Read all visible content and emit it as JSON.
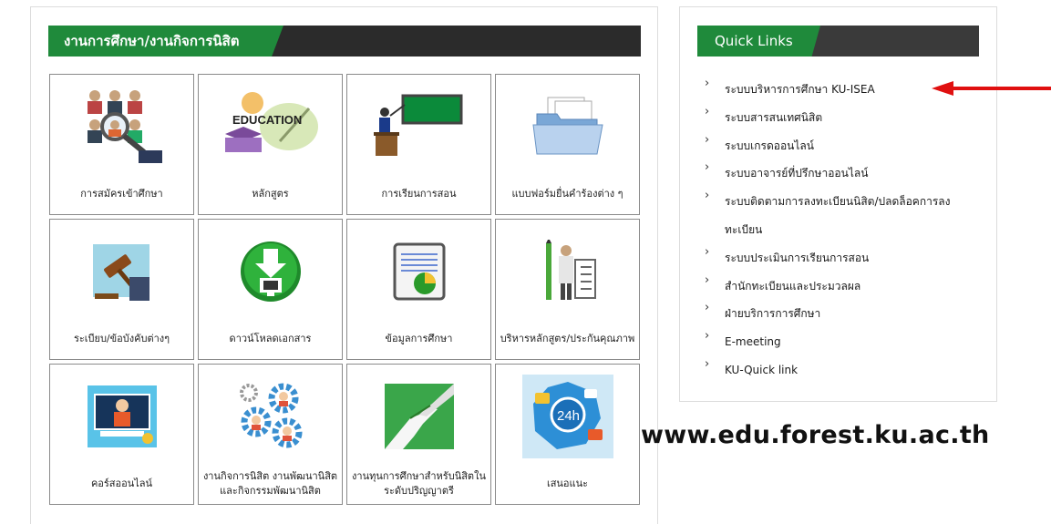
{
  "main": {
    "section_title": "งานการศึกษา/งานกิจการนิสิต",
    "tiles": [
      {
        "label": "การสมัครเข้าศึกษา",
        "icon": "applicants-magnifier-icon"
      },
      {
        "label": "หลักสูตร",
        "icon": "education-icon",
        "icon_text": "EDUCATION"
      },
      {
        "label": "การเรียนการสอน",
        "icon": "teacher-blackboard-icon"
      },
      {
        "label": "แบบฟอร์มยื่นคำร้องต่าง ๆ",
        "icon": "folder-documents-icon"
      },
      {
        "label": "ระเบียบ/ข้อบังคับต่างๆ",
        "icon": "gavel-icon"
      },
      {
        "label": "ดาวน์โหลดเอกสาร",
        "icon": "download-icon"
      },
      {
        "label": "ข้อมูลการศึกษา",
        "icon": "report-chart-icon"
      },
      {
        "label": "บริหารหลักสูตร/ประกันคุณภาพ",
        "icon": "checklist-pencil-icon"
      },
      {
        "label": "คอร์สออนไลน์",
        "icon": "online-course-icon"
      },
      {
        "label": "งานกิจการนิสิต งานพัฒนานิสิต และกิจกรรมพัฒนานิสิต",
        "icon": "people-gears-icon"
      },
      {
        "label": "งานทุนการศึกษาสำหรับนิสิตในระดับปริญญาตรี",
        "icon": "handshake-icon"
      },
      {
        "label": "เสนอแนะ",
        "icon": "support-24h-icon",
        "icon_text": "24h"
      }
    ]
  },
  "quick_links": {
    "title": "Quick Links",
    "items": [
      "ระบบบริหารการศึกษา KU-ISEA",
      "ระบบสารสนเทศนิสิต",
      "ระบบเกรดออนไลน์",
      "ระบบอาจารย์ที่ปรึกษาออนไลน์",
      "ระบบติดตามการลงทะเบียนนิสิต/ปลดล็อคการลงทะเบียน",
      "ระบบประเมินการเรียนการสอน",
      "สำนักทะเบียนและประมวลผล",
      "ฝ่ายบริการการศึกษา",
      "E-meeting",
      "KU-Quick link"
    ]
  },
  "annotation": {
    "site_url": "www.edu.forest.ku.ac.th",
    "arrow_color": "#e01010"
  },
  "colors": {
    "header_green": "#1f8a3b",
    "header_dark": "#2b2b2b"
  }
}
